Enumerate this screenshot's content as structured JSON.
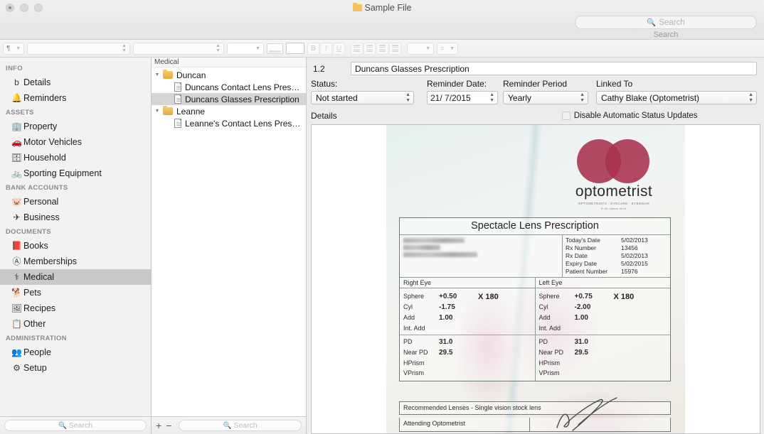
{
  "window": {
    "title": "Sample File",
    "folder_icon": "folder-icon",
    "traffic_lights": [
      "close",
      "minimize",
      "zoom"
    ]
  },
  "header_search": {
    "placeholder": "Search",
    "icon": "search-icon",
    "caption": "Search"
  },
  "toolbar": {
    "paragraph_style": "¶",
    "font_family": "",
    "font_style": "",
    "font_size": "",
    "buttons": [
      "text-color-swatch",
      "highlight-swatch",
      "bold",
      "italic",
      "underline",
      "align-left",
      "align-center",
      "align-right",
      "align-justify",
      "spacing",
      "list"
    ],
    "bold_label": "B",
    "italic_label": "I",
    "underline_label": "U"
  },
  "sidebar": {
    "groups": [
      {
        "header": "INFO",
        "items": [
          {
            "label": "Details",
            "icon": "document-icon",
            "glyph": "὜b",
            "selected": false
          },
          {
            "label": "Reminders",
            "icon": "bell-icon",
            "glyph": "🔔",
            "selected": false
          }
        ]
      },
      {
        "header": "ASSETS",
        "items": [
          {
            "label": "Property",
            "icon": "building-icon",
            "glyph": "🏢",
            "selected": false
          },
          {
            "label": "Motor Vehicles",
            "icon": "car-icon",
            "glyph": "🚗",
            "selected": false
          },
          {
            "label": "Household",
            "icon": "washing-machine-icon",
            "glyph": "🗄",
            "selected": false
          },
          {
            "label": "Sporting Equipment",
            "icon": "bicycle-icon",
            "glyph": "🚲",
            "selected": false
          }
        ]
      },
      {
        "header": "BANK ACCOUNTS",
        "items": [
          {
            "label": "Personal",
            "icon": "piggy-bank-icon",
            "glyph": "🐷",
            "selected": false
          },
          {
            "label": "Business",
            "icon": "briefcase-icon",
            "glyph": "✈",
            "selected": false
          }
        ]
      },
      {
        "header": "DOCUMENTS",
        "items": [
          {
            "label": "Books",
            "icon": "book-icon",
            "glyph": "📕",
            "selected": false
          },
          {
            "label": "Memberships",
            "icon": "membership-card-icon",
            "glyph": "Ⓐ",
            "selected": false
          },
          {
            "label": "Medical",
            "icon": "caduceus-icon",
            "glyph": "⚕",
            "selected": true
          },
          {
            "label": "Pets",
            "icon": "paw-icon",
            "glyph": "🐕",
            "selected": false
          },
          {
            "label": "Recipes",
            "icon": "recipe-card-icon",
            "glyph": "🖼",
            "selected": false
          },
          {
            "label": "Other",
            "icon": "clipboard-icon",
            "glyph": "📋",
            "selected": false
          }
        ]
      },
      {
        "header": "ADMINISTRATION",
        "items": [
          {
            "label": "People",
            "icon": "people-icon",
            "glyph": "👥",
            "selected": false
          },
          {
            "label": "Setup",
            "icon": "gear-icon",
            "glyph": "⚙",
            "selected": false
          }
        ]
      }
    ],
    "search_placeholder": "Search"
  },
  "tree": {
    "header": "Medical",
    "nodes": [
      {
        "label": "Duncan",
        "type": "folder",
        "depth": 0,
        "expanded": true,
        "selected": false
      },
      {
        "label": "Duncans Contact Lens Pres…",
        "type": "file",
        "depth": 1,
        "selected": false
      },
      {
        "label": "Duncans Glasses Prescription",
        "type": "file",
        "depth": 1,
        "selected": true
      },
      {
        "label": "Leanne",
        "type": "folder",
        "depth": 0,
        "expanded": true,
        "selected": false
      },
      {
        "label": "Leanne's Contact Lens Pres…",
        "type": "file",
        "depth": 1,
        "selected": false
      }
    ],
    "add_label": "+",
    "remove_label": "−",
    "search_placeholder": "Search"
  },
  "detail": {
    "version": "1.2",
    "title_value": "Duncans Glasses Prescription",
    "status": {
      "label": "Status:",
      "value": "Not started"
    },
    "reminder_date": {
      "label": "Reminder Date:",
      "value": "21/ 7/2015"
    },
    "reminder_period": {
      "label": "Reminder Period",
      "value": "Yearly"
    },
    "linked_to": {
      "label": "Linked To",
      "value": "Cathy Blake (Optometrist)"
    },
    "details_label": "Details",
    "disable_updates": {
      "label": "Disable Automatic Status Updates",
      "checked": false
    }
  },
  "scan": {
    "logo": {
      "word": "optometrist",
      "sub": "OPTOMETRISTS  ·  EYECARE  ·  EYEWEAR",
      "sub2": "B. Sc. Optom. M.r.b.",
      "color": "#a8304c"
    },
    "title": "Spectacle Lens Prescription",
    "meta": [
      {
        "key": "Today's Date",
        "value": "5/02/2013"
      },
      {
        "key": "Rx Number",
        "value": "13456"
      },
      {
        "key": "Rx Date",
        "value": "5/02/2013"
      },
      {
        "key": "Expiry Date",
        "value": "5/02/2015"
      },
      {
        "key": "Patient Number",
        "value": "15976"
      }
    ],
    "right_eye": {
      "header": "Right Eye",
      "axis": "X  180",
      "rows": [
        {
          "key": "Sphere",
          "value": "+0.50"
        },
        {
          "key": "Cyl",
          "value": "-1.75"
        },
        {
          "key": "Add",
          "value": "1.00"
        },
        {
          "key": "Int. Add",
          "value": ""
        },
        {
          "key": "PD",
          "value": "31.0"
        },
        {
          "key": "Near PD",
          "value": "29.5"
        },
        {
          "key": "HPrism",
          "value": ""
        },
        {
          "key": "VPrism",
          "value": ""
        }
      ]
    },
    "left_eye": {
      "header": "Left Eye",
      "axis": "X  180",
      "rows": [
        {
          "key": "Sphere",
          "value": "+0.75"
        },
        {
          "key": "Cyl",
          "value": "-2.00"
        },
        {
          "key": "Add",
          "value": "1.00"
        },
        {
          "key": "Int. Add",
          "value": ""
        },
        {
          "key": "PD",
          "value": "31.0"
        },
        {
          "key": "Near PD",
          "value": "29.5"
        },
        {
          "key": "HPrism",
          "value": ""
        },
        {
          "key": "VPrism",
          "value": ""
        }
      ]
    },
    "recommended": "Recommended Lenses - Single vision stock lens",
    "attending": "Attending Optometrist"
  }
}
